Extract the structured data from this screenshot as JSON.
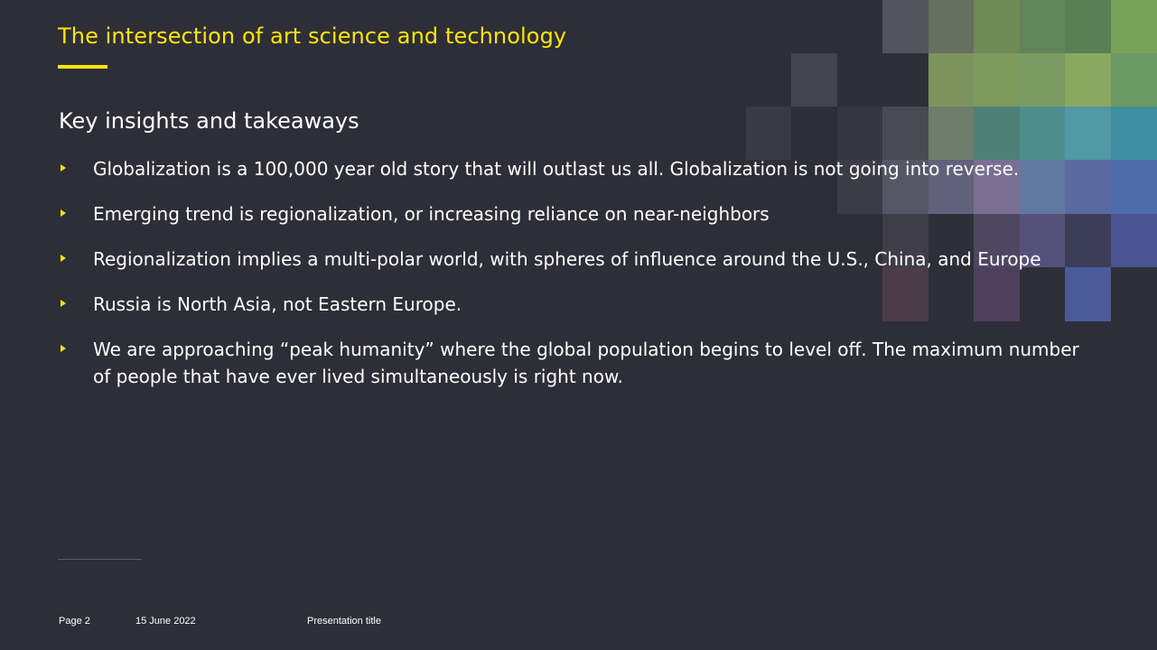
{
  "slide": {
    "title": "The intersection of art science and technology",
    "subtitle": "Key insights and takeaways",
    "bullets": [
      "Globalization is a 100,000 year old story that will outlast us all. Globalization is not going into reverse.",
      "Emerging trend is regionalization, or increasing reliance on near-neighbors",
      "Regionalization implies a multi-polar world, with spheres of influence around the U.S., China, and Europe",
      "Russia is North Asia, not Eastern Europe.",
      "We are approaching “peak humanity” where the global population begins to level off. The maximum number of people that have ever lived simultaneously is right now."
    ]
  },
  "footer": {
    "page": "Page 2",
    "date": "15 June 2022",
    "presentation": "Presentation title"
  },
  "colors": {
    "background": "#2e2e38",
    "accent": "#ffe600",
    "text": "#ffffff",
    "bullet_marker": "#ffe600"
  },
  "icons": {
    "bullet": "triangle-right-icon"
  }
}
